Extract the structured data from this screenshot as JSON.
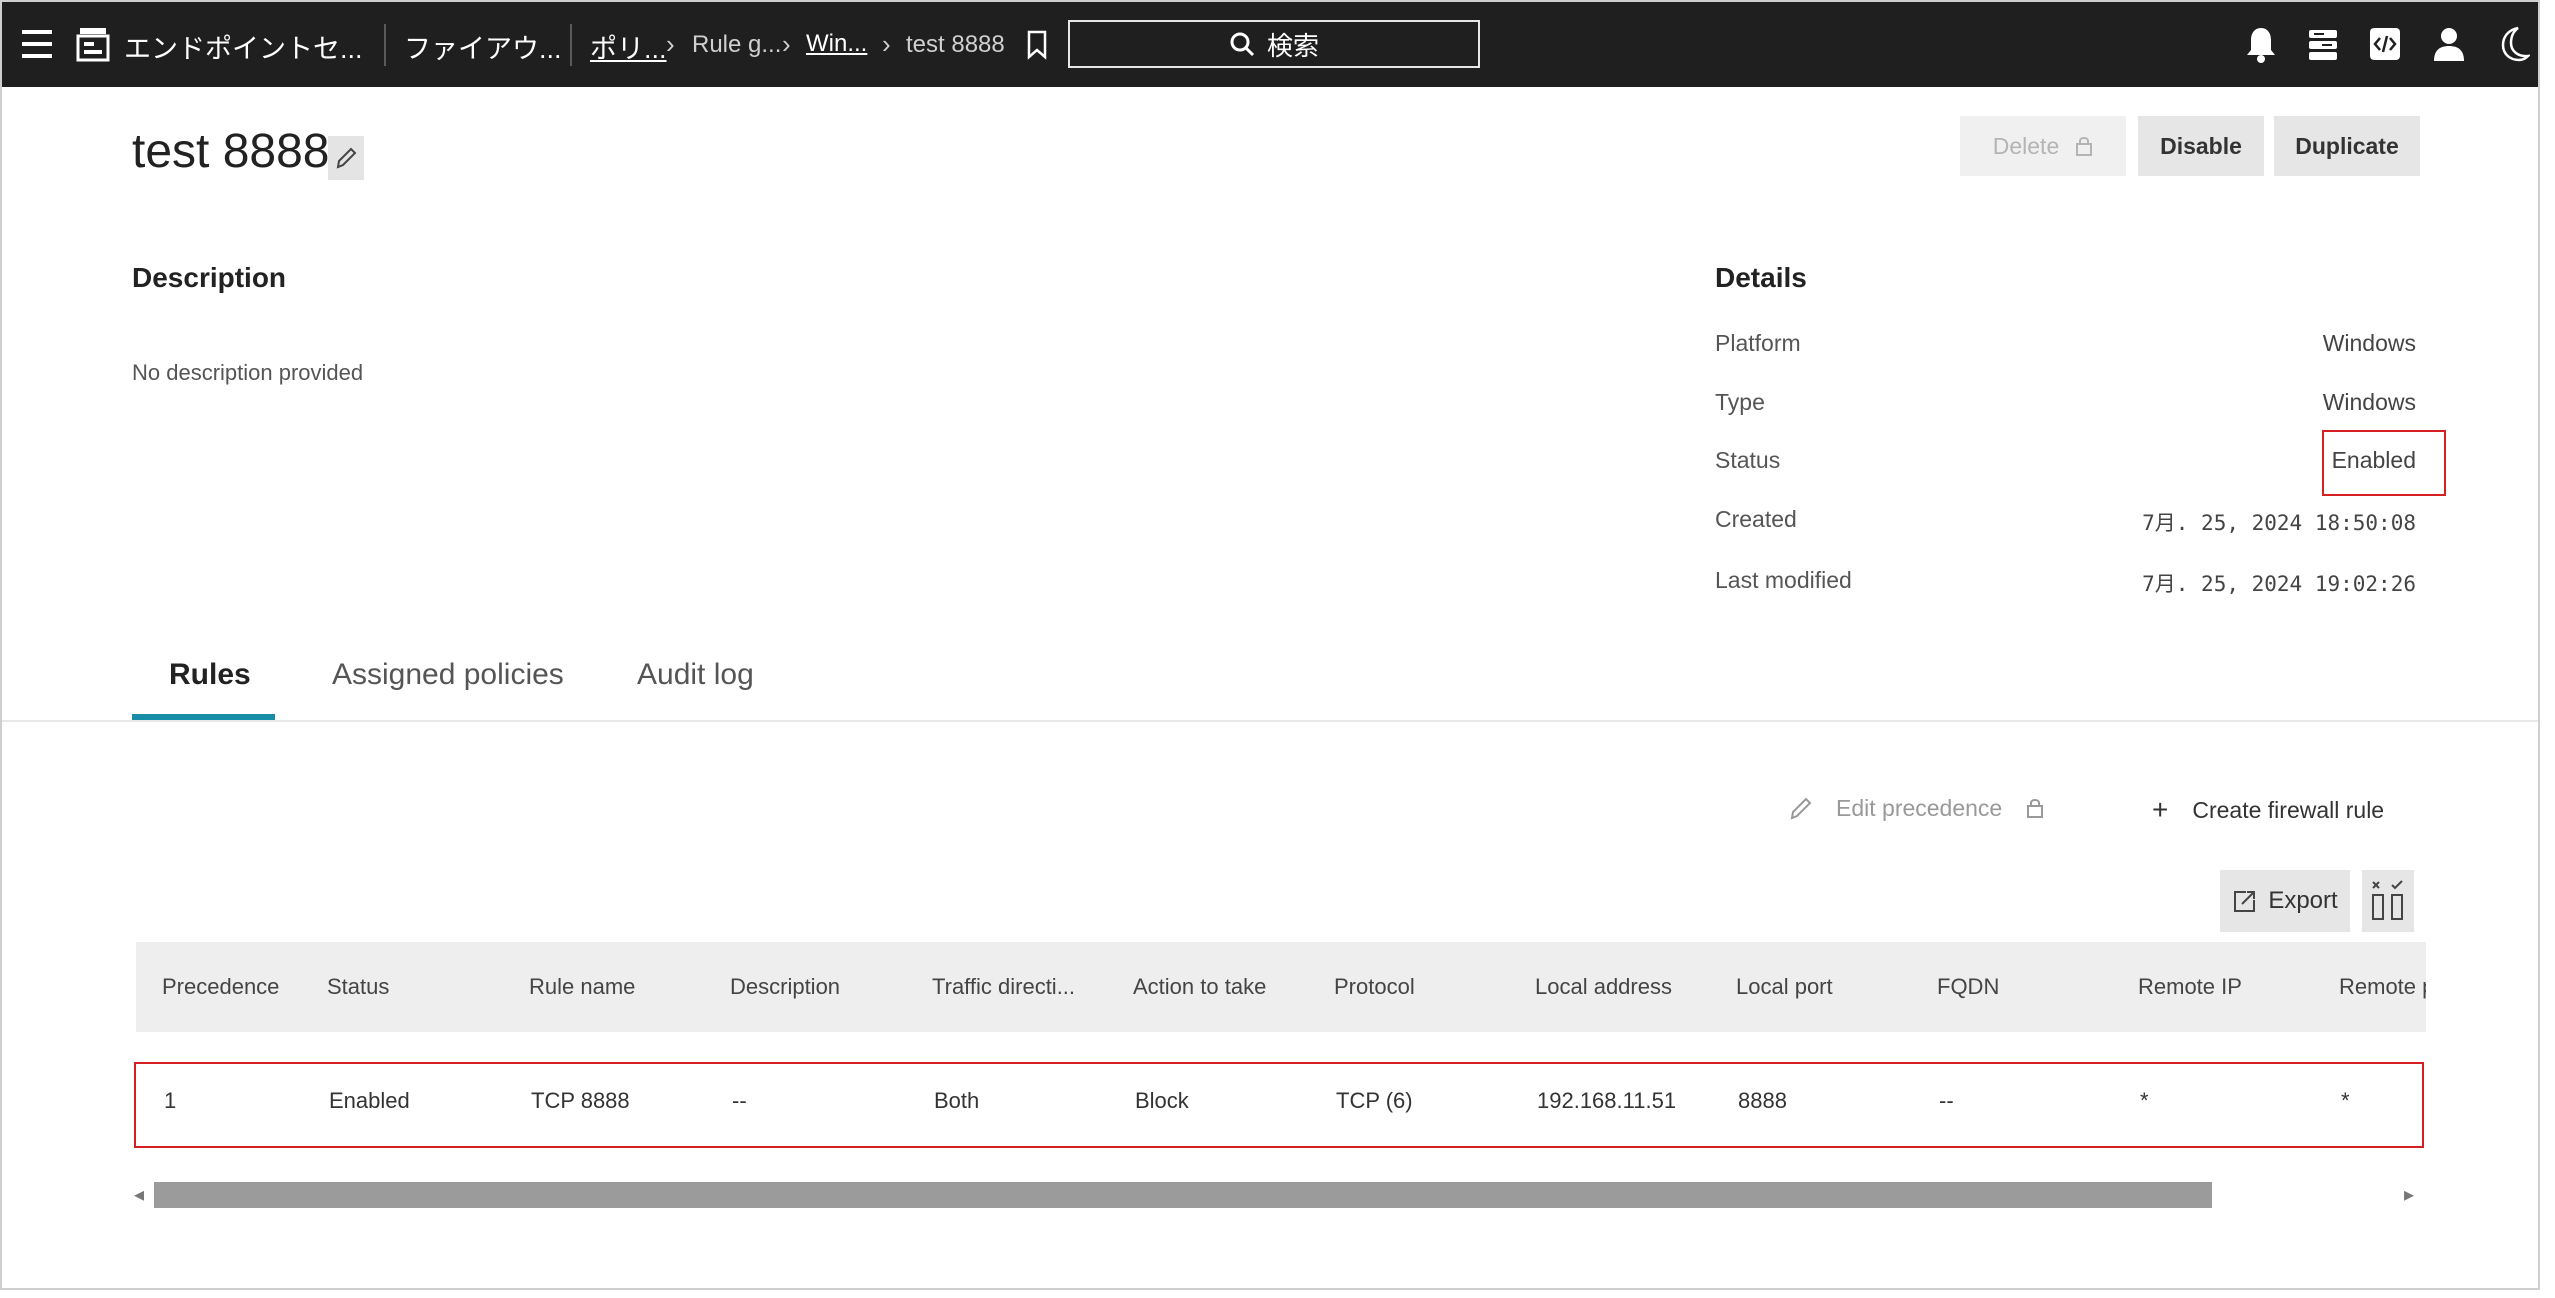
{
  "topbar": {
    "app_name": "エンドポイントセ...",
    "breadcrumbs": [
      "ファイアウ...",
      "ポリ...",
      "Rule g...",
      "Win...",
      "test 8888"
    ],
    "search_label": "検索"
  },
  "header": {
    "title": "test 8888",
    "buttons": {
      "delete": "Delete",
      "disable": "Disable",
      "duplicate": "Duplicate"
    }
  },
  "description": {
    "heading": "Description",
    "text": "No description provided"
  },
  "details": {
    "heading": "Details",
    "rows": [
      {
        "label": "Platform",
        "value": "Windows"
      },
      {
        "label": "Type",
        "value": "Windows"
      },
      {
        "label": "Status",
        "value": "Enabled"
      },
      {
        "label": "Created",
        "value": "7月. 25, 2024 18:50:08"
      },
      {
        "label": "Last modified",
        "value": "7月. 25, 2024 19:02:26"
      }
    ]
  },
  "tabs": [
    "Rules",
    "Assigned policies",
    "Audit log"
  ],
  "rules_actions": {
    "edit_precedence": "Edit precedence",
    "create_rule": "Create firewall rule",
    "export": "Export"
  },
  "table": {
    "headers": [
      "Precedence",
      "Status",
      "Rule name",
      "Description",
      "Traffic directi...",
      "Action to take",
      "Protocol",
      "Local address",
      "Local port",
      "FQDN",
      "Remote IP",
      "Remote p"
    ],
    "rows": [
      [
        "1",
        "Enabled",
        "TCP 8888",
        "--",
        "Both",
        "Block",
        "TCP (6)",
        "192.168.11.51",
        "8888",
        "--",
        "*",
        "*"
      ]
    ]
  },
  "colors": {
    "topbar": "#1f1f1f",
    "tab_accent": "#178da8",
    "highlight": "#d42020"
  }
}
